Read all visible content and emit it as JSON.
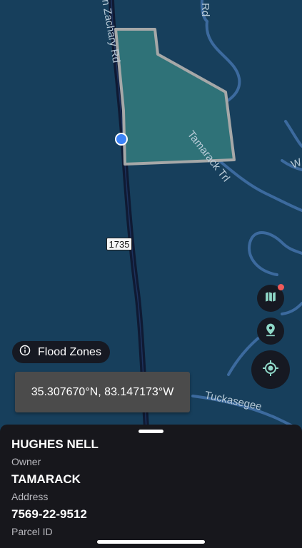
{
  "map": {
    "roads": [
      {
        "name": "Zachary Rd",
        "label": "n Zachary Rd"
      },
      {
        "name": "Tamarack Trl",
        "label": "Tamarack Trl"
      },
      {
        "name": "Tuckasegee",
        "label": "Tuckasegee"
      },
      {
        "name": "Rd fragment",
        "label": "Rd"
      },
      {
        "name": "W fragment",
        "label": "W"
      }
    ],
    "route_number": "1735",
    "colors": {
      "water": "#173f5c",
      "minor_road": "#3c6a9e",
      "major_road": "#0f1a33",
      "parcel_fill": "#2f7278",
      "parcel_stroke": "#a6a8a8",
      "location_dot": "#3b82f6"
    }
  },
  "controls": {
    "layers_button_icon": "map-icon",
    "pin_button_icon": "pin-icon",
    "locate_button_icon": "crosshair-icon"
  },
  "flood_chip": {
    "icon": "info-icon",
    "label": "Flood Zones"
  },
  "coordinates": {
    "text": "35.307670°N, 83.147173°W"
  },
  "parcel": {
    "owner": {
      "value": "HUGHES NELL",
      "label": "Owner"
    },
    "address": {
      "value": "TAMARACK",
      "label": "Address"
    },
    "parcel_id": {
      "value": "7569-22-9512",
      "label": "Parcel ID"
    }
  }
}
